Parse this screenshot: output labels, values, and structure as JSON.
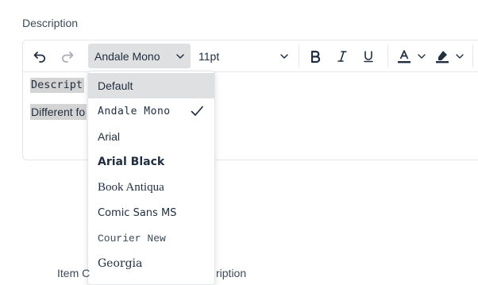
{
  "section_label": "Description",
  "toolbar": {
    "font_family_value": "Andale Mono",
    "font_size_value": "11pt",
    "undo_icon": "undo-icon",
    "redo_icon": "redo-icon",
    "bold_icon": "bold-icon",
    "italic_icon": "italic-icon",
    "underline_icon": "underline-icon",
    "text_color_icon": "text-color-icon",
    "highlight_icon": "highlight-icon"
  },
  "content": {
    "line1": "Descript",
    "line2": "Different fo"
  },
  "font_menu": {
    "selected": "Andale Mono",
    "items": [
      {
        "label": "Default",
        "font": "Liberation Sans"
      },
      {
        "label": "Andale Mono",
        "font": "DejaVu Sans Mono"
      },
      {
        "label": "Arial",
        "font": "Liberation Sans"
      },
      {
        "label": "Arial Black",
        "font": "DejaVu Sans"
      },
      {
        "label": "Book Antiqua",
        "font": "Liberation Serif"
      },
      {
        "label": "Comic Sans MS",
        "font": "DejaVu Sans"
      },
      {
        "label": "Courier New",
        "font": "Liberation Mono"
      },
      {
        "label": "Georgia",
        "font": "DejaVu Serif"
      }
    ]
  },
  "footer": {
    "left": "Item C",
    "right": "ription"
  },
  "colors": {
    "toolbar_active": "#dee0e2",
    "text": "#222f3e",
    "border": "#e3e6ea",
    "selection": "#d4d4d4"
  }
}
